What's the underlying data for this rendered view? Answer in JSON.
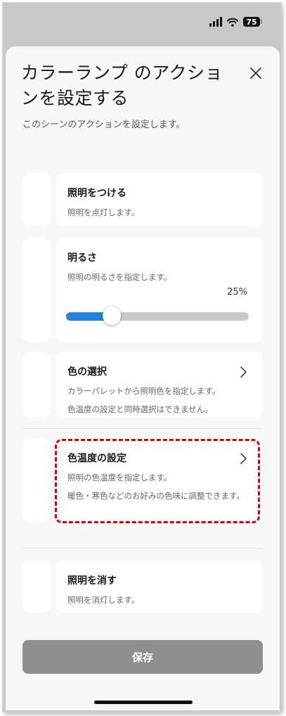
{
  "status_bar": {
    "battery": "75"
  },
  "sheet": {
    "title": "カラーランプ のアクションを設定する",
    "subtitle": "このシーンのアクションを設定します。"
  },
  "actions": [
    {
      "title": "照明をつける",
      "description": "照明を点灯します。"
    },
    {
      "title": "明るさ",
      "description": "照明の明るさを指定します。",
      "value_label": "25%",
      "value": 0.25
    },
    {
      "title": "色の選択",
      "description": "カラーパレットから照明色を指定します。",
      "note": "色温度の設定と同時選択はできません。"
    },
    {
      "title": "色温度の設定",
      "description": "照明の色温度を指定します。",
      "note": "暖色・寒色などのお好みの色味に調整できます。"
    },
    {
      "title": "照明を消す",
      "description": "照明を消灯します。"
    }
  ],
  "footer": {
    "save_label": "保存"
  },
  "colors": {
    "accent": "#2383d8",
    "highlight": "#e00000",
    "save_bg": "#8e8e8e"
  }
}
